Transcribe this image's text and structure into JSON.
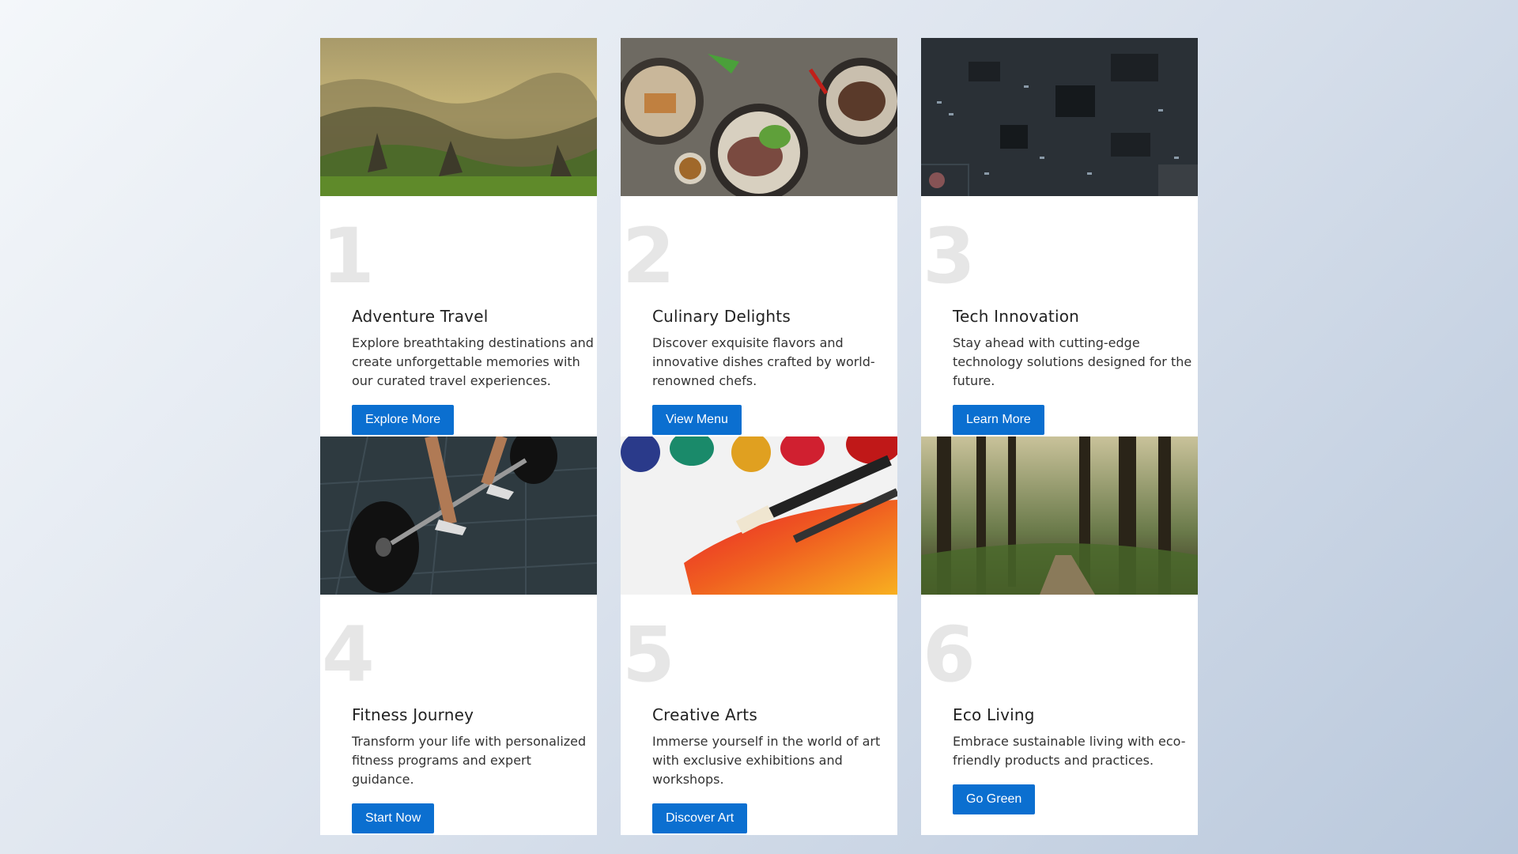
{
  "cards": [
    {
      "number": "1",
      "title": "Adventure Travel",
      "text": "Explore breathtaking destinations and create unforgettable memories with our curated travel experiences.",
      "button": "Explore More",
      "image": "mountain-landscape-image"
    },
    {
      "number": "2",
      "title": "Culinary Delights",
      "text": "Discover exquisite flavors and innovative dishes crafted by world-renowned chefs.",
      "button": "View Menu",
      "image": "food-plates-image"
    },
    {
      "number": "3",
      "title": "Tech Innovation",
      "text": "Stay ahead with cutting-edge technology solutions designed for the future.",
      "button": "Learn More",
      "image": "circuit-board-image"
    },
    {
      "number": "4",
      "title": "Fitness Journey",
      "text": "Transform your life with personalized fitness programs and expert guidance.",
      "button": "Start Now",
      "image": "barbell-workout-image"
    },
    {
      "number": "5",
      "title": "Creative Arts",
      "text": "Immerse yourself in the world of art with exclusive exhibitions and workshops.",
      "button": "Discover Art",
      "image": "paint-brushes-image"
    },
    {
      "number": "6",
      "title": "Eco Living",
      "text": "Embrace sustainable living with eco-friendly products and practices.",
      "button": "Go Green",
      "image": "forest-path-image"
    }
  ],
  "colors": {
    "button": "#0b6fd0",
    "number": "#e6e6e6",
    "card": "#ffffff"
  }
}
